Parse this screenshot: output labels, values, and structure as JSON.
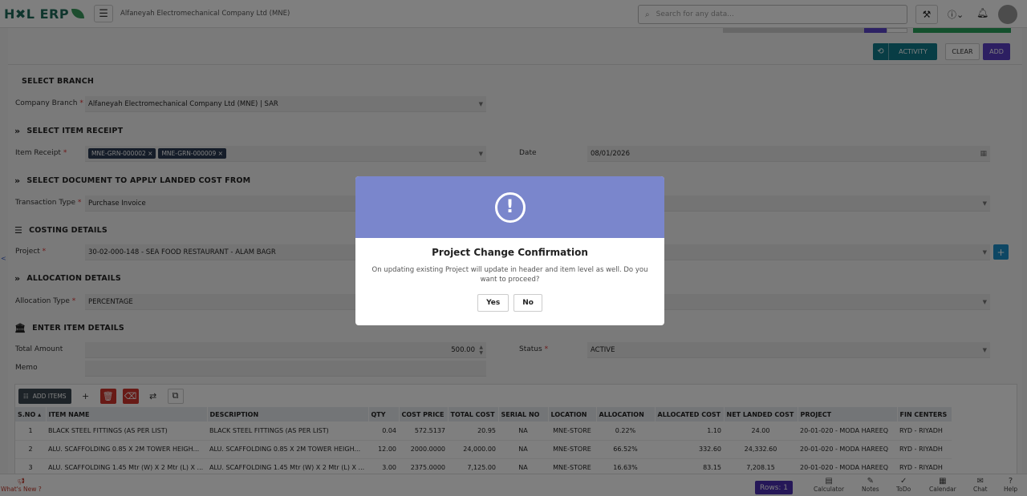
{
  "app": {
    "logo": "H✖L ERP",
    "company_title": "Alfaneyah Electromechanical Company Ltd (MNE)",
    "search_placeholder": "Search for any data...",
    "menu_icon": "hamburger-icon",
    "tools_icon": "tools-icon",
    "info_icon": "info-icon",
    "bell_icon": "bell-icon"
  },
  "actions": {
    "activity": "ACTIVITY",
    "clear": "CLEAR",
    "add": "ADD"
  },
  "branch": {
    "section": "SELECT BRANCH",
    "label": "Company Branch",
    "value": "Alfaneyah Electromechanical Company Ltd (MNE) | SAR"
  },
  "receipt": {
    "section": "SELECT ITEM RECEIPT",
    "label": "Item Receipt",
    "chips": [
      "MNE-GRN-000002 ×",
      "MNE-GRN-000009 ×"
    ],
    "date_label": "Date",
    "date_value": "08/01/2026"
  },
  "document": {
    "section": "SELECT DOCUMENT TO APPLY LANDED COST FROM",
    "label": "Transaction Type",
    "value": "Purchase Invoice"
  },
  "costing": {
    "section": "COSTING DETAILS",
    "label": "Project",
    "value": "30-02-000-148 - SEA FOOD RESTAURANT - ALAM BAGR"
  },
  "allocation": {
    "section": "ALLOCATION DETAILS",
    "label": "Allocation Type",
    "value": "PERCENTAGE"
  },
  "items": {
    "section": "ENTER ITEM DETAILS",
    "total_label": "Total Amount",
    "total_value": "500.00",
    "status_label": "Status",
    "status_value": "ACTIVE",
    "memo_label": "Memo",
    "add_items": "ADD ITEMS"
  },
  "grid": {
    "columns": [
      "S.NO ▴",
      "ITEM NAME",
      "DESCRIPTION",
      "QTY",
      "COST PRICE",
      "TOTAL COST",
      "SERIAL NO",
      "LOCATION",
      "ALLOCATION",
      "ALLOCATED COST",
      "NET LANDED COST",
      "PROJECT",
      "FIN CENTERS"
    ],
    "rows": [
      [
        "1",
        "BLACK STEEL FITTINGS (AS PER LIST)",
        "BLACK STEEL FITTINGS (AS PER LIST)",
        "0.04",
        "572.5137",
        "20.95",
        "NA",
        "MNE-STORE",
        "0.22%",
        "1.10",
        "24.00",
        "20-01-020 - MODA HAREEQ",
        "RYD - RIYADH"
      ],
      [
        "2",
        "ALU. SCAFFOLDING 0.85 X 2M TOWER HEIGH...",
        "ALU. SCAFFOLDING 0.85 X 2M TOWER HEIGH...",
        "12.00",
        "2000.0000",
        "24,000.00",
        "NA",
        "MNE-STORE",
        "66.52%",
        "332.60",
        "24,332.60",
        "20-01-020 - MODA HAREEQ",
        "RYD - RIYADH"
      ],
      [
        "3",
        "ALU. SCAFFOLDING 1.45 Mtr (W) X 2 Mtr (L) X ...",
        "ALU. SCAFFOLDING 1.45 Mtr (W) X 2 Mtr (L) X ...",
        "3.00",
        "2375.0000",
        "7,125.00",
        "NA",
        "MNE-STORE",
        "16.63%",
        "83.15",
        "7,208.15",
        "20-01-020 - MODA HAREEQ",
        "RYD - RIYADH"
      ]
    ]
  },
  "footer": {
    "whats_new": "What's New ?",
    "rows": "Rows: 1",
    "calculator": "Calculator",
    "notes": "Notes",
    "todo": "ToDo",
    "calendar": "Calendar",
    "chat": "Chat",
    "help": "Help"
  },
  "modal": {
    "icon": "exclamation-circle-icon",
    "title": "Project Change Confirmation",
    "text": "On updating existing Project will update in header and item level as well. Do you want to proceed?",
    "yes": "Yes",
    "no": "No"
  },
  "colors": {
    "modal_header": "#7a86cc",
    "add_button": "#5a3fc4",
    "activity_button": "#117a8b",
    "chip": "#2b3b52",
    "delete_red": "#d0342c"
  }
}
